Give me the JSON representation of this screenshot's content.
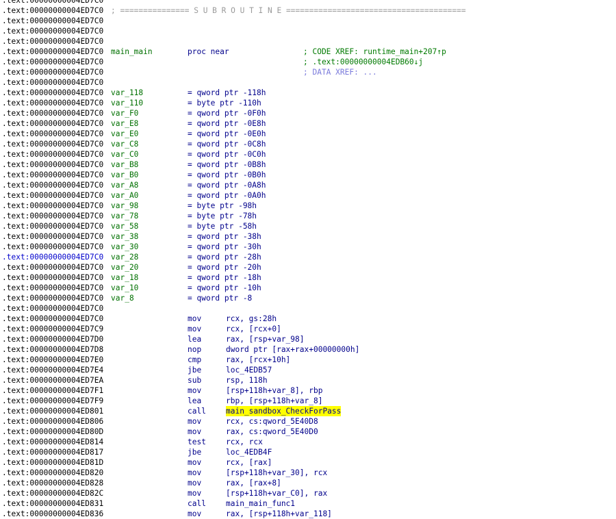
{
  "listing": [
    {
      "addr": ".text:00000000004ED7C0"
    },
    {
      "addr": ".text:00000000004ED7C0",
      "sub": "; =============== S U B R O U T I N E ======================================="
    },
    {
      "addr": ".text:00000000004ED7C0"
    },
    {
      "addr": ".text:00000000004ED7C0"
    },
    {
      "addr": ".text:00000000004ED7C0"
    },
    {
      "addr": ".text:00000000004ED7C0",
      "sym": "main_main",
      "op": "proc near",
      "cmt": "; CODE XREF: runtime_main+207↑p"
    },
    {
      "addr": ".text:00000000004ED7C0",
      "cmt": "; .text:00000000004EDB60↓j"
    },
    {
      "addr": ".text:00000000004ED7C0",
      "cmt": "; DATA XREF: ...",
      "xref": true
    },
    {
      "addr": ".text:00000000004ED7C0"
    },
    {
      "addr": ".text:00000000004ED7C0",
      "sym": "var_118",
      "op": "= qword ptr -118h"
    },
    {
      "addr": ".text:00000000004ED7C0",
      "sym": "var_110",
      "op": "= byte ptr -110h"
    },
    {
      "addr": ".text:00000000004ED7C0",
      "sym": "var_F0",
      "op": "= qword ptr -0F0h"
    },
    {
      "addr": ".text:00000000004ED7C0",
      "sym": "var_E8",
      "op": "= qword ptr -0E8h"
    },
    {
      "addr": ".text:00000000004ED7C0",
      "sym": "var_E0",
      "op": "= qword ptr -0E0h"
    },
    {
      "addr": ".text:00000000004ED7C0",
      "sym": "var_C8",
      "op": "= qword ptr -0C8h"
    },
    {
      "addr": ".text:00000000004ED7C0",
      "sym": "var_C0",
      "op": "= qword ptr -0C0h"
    },
    {
      "addr": ".text:00000000004ED7C0",
      "sym": "var_B8",
      "op": "= qword ptr -0B8h"
    },
    {
      "addr": ".text:00000000004ED7C0",
      "sym": "var_B0",
      "op": "= qword ptr -0B0h"
    },
    {
      "addr": ".text:00000000004ED7C0",
      "sym": "var_A8",
      "op": "= qword ptr -0A8h"
    },
    {
      "addr": ".text:00000000004ED7C0",
      "sym": "var_A0",
      "op": "= qword ptr -0A0h"
    },
    {
      "addr": ".text:00000000004ED7C0",
      "sym": "var_98",
      "op": "= byte ptr -98h"
    },
    {
      "addr": ".text:00000000004ED7C0",
      "sym": "var_78",
      "op": "= byte ptr -78h"
    },
    {
      "addr": ".text:00000000004ED7C0",
      "sym": "var_58",
      "op": "= byte ptr -58h"
    },
    {
      "addr": ".text:00000000004ED7C0",
      "sym": "var_38",
      "op": "= qword ptr -38h"
    },
    {
      "addr": ".text:00000000004ED7C0",
      "sym": "var_30",
      "op": "= qword ptr -30h"
    },
    {
      "addr": ".text:00000000004ED7C0",
      "sym": "var_28",
      "op": "= qword ptr -28h",
      "selected": true
    },
    {
      "addr": ".text:00000000004ED7C0",
      "sym": "var_20",
      "op": "= qword ptr -20h"
    },
    {
      "addr": ".text:00000000004ED7C0",
      "sym": "var_18",
      "op": "= qword ptr -18h"
    },
    {
      "addr": ".text:00000000004ED7C0",
      "sym": "var_10",
      "op": "= qword ptr -10h"
    },
    {
      "addr": ".text:00000000004ED7C0",
      "sym": "var_8",
      "op": "= qword ptr -8"
    },
    {
      "addr": ".text:00000000004ED7C0"
    },
    {
      "addr": ".text:00000000004ED7C0",
      "op": "mov",
      "arg": "rcx, gs:28h"
    },
    {
      "addr": ".text:00000000004ED7C9",
      "op": "mov",
      "arg": "rcx, [rcx+0]"
    },
    {
      "addr": ".text:00000000004ED7D0",
      "op": "lea",
      "arg": "rax, [rsp+var_98]"
    },
    {
      "addr": ".text:00000000004ED7D8",
      "op": "nop",
      "arg": "dword ptr [rax+rax+00000000h]"
    },
    {
      "addr": ".text:00000000004ED7E0",
      "op": "cmp",
      "arg": "rax, [rcx+10h]"
    },
    {
      "addr": ".text:00000000004ED7E4",
      "op": "jbe",
      "arg": "loc_4EDB57"
    },
    {
      "addr": ".text:00000000004ED7EA",
      "op": "sub",
      "arg": "rsp, 118h"
    },
    {
      "addr": ".text:00000000004ED7F1",
      "op": "mov",
      "arg": "[rsp+118h+var_8], rbp"
    },
    {
      "addr": ".text:00000000004ED7F9",
      "op": "lea",
      "arg": "rbp, [rsp+118h+var_8]"
    },
    {
      "addr": ".text:00000000004ED801",
      "op": "call",
      "arg": "main_sandbox_CheckForPass",
      "highlight": true
    },
    {
      "addr": ".text:00000000004ED806",
      "op": "mov",
      "arg": "rcx, cs:qword_5E40D8"
    },
    {
      "addr": ".text:00000000004ED80D",
      "op": "mov",
      "arg": "rax, cs:qword_5E40D0"
    },
    {
      "addr": ".text:00000000004ED814",
      "op": "test",
      "arg": "rcx, rcx"
    },
    {
      "addr": ".text:00000000004ED817",
      "op": "jbe",
      "arg": "loc_4EDB4F"
    },
    {
      "addr": ".text:00000000004ED81D",
      "op": "mov",
      "arg": "rcx, [rax]"
    },
    {
      "addr": ".text:00000000004ED820",
      "op": "mov",
      "arg": "[rsp+118h+var_30], rcx"
    },
    {
      "addr": ".text:00000000004ED828",
      "op": "mov",
      "arg": "rax, [rax+8]"
    },
    {
      "addr": ".text:00000000004ED82C",
      "op": "mov",
      "arg": "[rsp+118h+var_C0], rax"
    },
    {
      "addr": ".text:00000000004ED831",
      "op": "call",
      "arg": "main_main_func1"
    },
    {
      "addr": ".text:00000000004ED836",
      "op": "mov",
      "arg": "rax, [rsp+118h+var_118]"
    }
  ]
}
